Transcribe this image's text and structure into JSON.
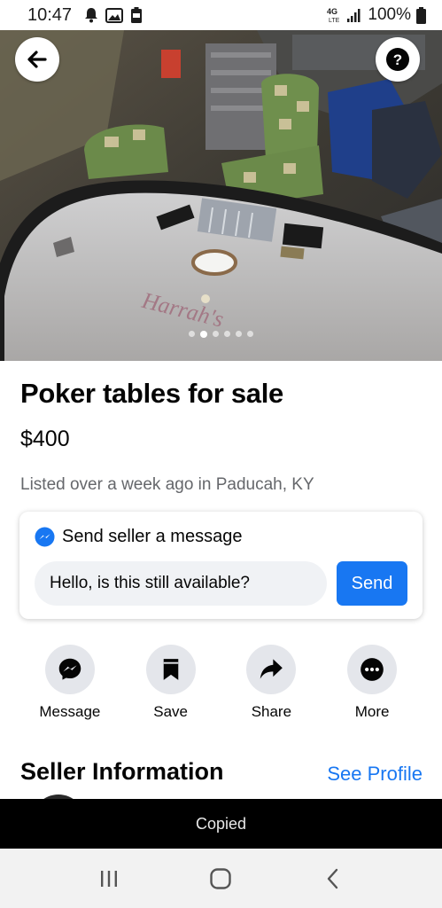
{
  "status_bar": {
    "time": "10:47",
    "network": "4G LTE",
    "battery": "100%",
    "icons": [
      "alarm-bell-icon",
      "image-icon",
      "battery-saver-icon",
      "signal-icon",
      "battery-icon"
    ]
  },
  "hero": {
    "back_icon": "arrow-left-icon",
    "help_icon": "question-mark-icon",
    "photo_count": 6,
    "active_photo_index": 1
  },
  "listing": {
    "title": "Poker tables for sale",
    "price": "$400",
    "listed": "Listed over a week ago in Paducah, KY"
  },
  "message_card": {
    "heading": "Send seller a message",
    "input_value": "Hello, is this still available?",
    "send_label": "Send"
  },
  "actions": [
    {
      "label": "Message",
      "icon": "messenger-icon"
    },
    {
      "label": "Save",
      "icon": "bookmark-icon"
    },
    {
      "label": "Share",
      "icon": "share-arrow-icon"
    },
    {
      "label": "More",
      "icon": "more-dots-icon"
    }
  ],
  "seller": {
    "heading": "Seller Information",
    "see_profile": "See Profile"
  },
  "toast": {
    "text": "Copied"
  },
  "nav_bar": {
    "icons": [
      "recent-apps-icon",
      "home-icon",
      "back-icon"
    ]
  },
  "colors": {
    "accent": "#1877f2",
    "secondary_text": "#65676b",
    "action_bg": "#e4e6eb",
    "input_bg": "#f0f2f5",
    "toast_bg": "#000000"
  }
}
